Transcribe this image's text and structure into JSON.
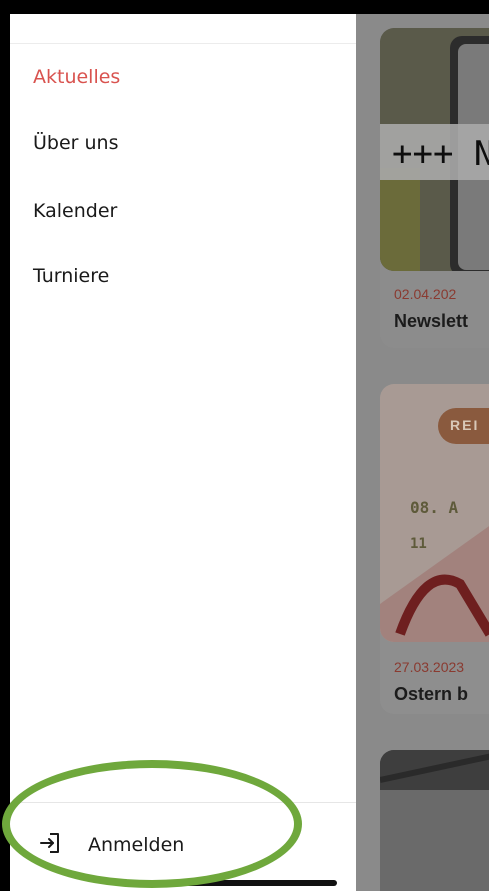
{
  "drawer": {
    "items": [
      {
        "label": "Aktuelles",
        "active": true
      },
      {
        "label": "Über uns",
        "active": false
      },
      {
        "label": "Kalender",
        "active": false
      },
      {
        "label": "Turniere",
        "active": false
      }
    ],
    "login_label": "Anmelden",
    "login_icon": "login-icon"
  },
  "content": {
    "cards": [
      {
        "banner_text": "+++ Ne",
        "date": "02.04.202",
        "title": "Newslett"
      },
      {
        "badge_text": "REI",
        "poster_text_1": "08. A",
        "poster_text_2": "11",
        "date": "27.03.2023",
        "title": "Ostern b"
      }
    ]
  },
  "colors": {
    "active": "#d9534f",
    "highlight": "#6fa83c"
  }
}
